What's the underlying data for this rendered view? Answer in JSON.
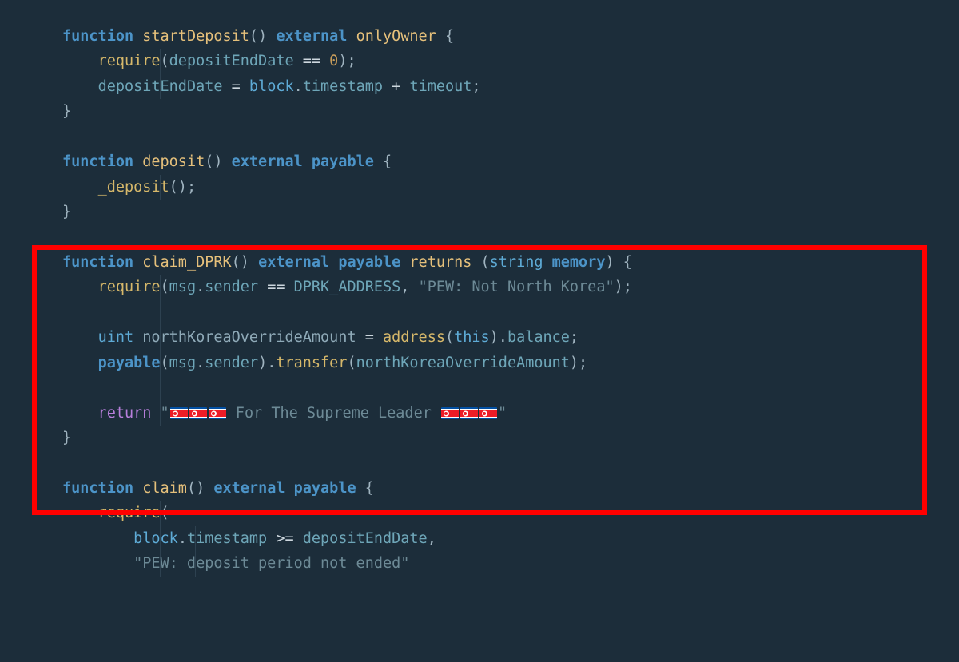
{
  "code": {
    "keywords": {
      "function": "function",
      "external": "external",
      "payable": "payable",
      "returns": "returns",
      "return": "return",
      "memory": "memory",
      "uint": "uint"
    },
    "functions": {
      "startDeposit": "startDeposit",
      "deposit": "deposit",
      "claim_DPRK": "claim_DPRK",
      "claim": "claim"
    },
    "modifiers": {
      "onlyOwner": "onlyOwner"
    },
    "calls": {
      "require": "require",
      "_deposit": "_deposit",
      "address": "address",
      "payable_call": "payable",
      "transfer": "transfer"
    },
    "identifiers": {
      "depositEndDate": "depositEndDate",
      "block": "block",
      "timestamp": "timestamp",
      "timeout": "timeout",
      "msg": "msg",
      "sender": "sender",
      "DPRK_ADDRESS": "DPRK_ADDRESS",
      "northKoreaOverrideAmount": "northKoreaOverrideAmount",
      "this": "this",
      "balance": "balance",
      "string": "string"
    },
    "strings": {
      "pew_not_nk": "\"PEW: Not North Korea\"",
      "supreme_prefix": "\"",
      "supreme_text": " For The Supreme Leader ",
      "supreme_suffix": "\"",
      "pew_deposit": "\"PEW: deposit period not ended\""
    },
    "numbers": {
      "zero": "0"
    },
    "operators": {
      "eq": "==",
      "assign": "=",
      "plus": "+",
      "gte": ">="
    }
  }
}
